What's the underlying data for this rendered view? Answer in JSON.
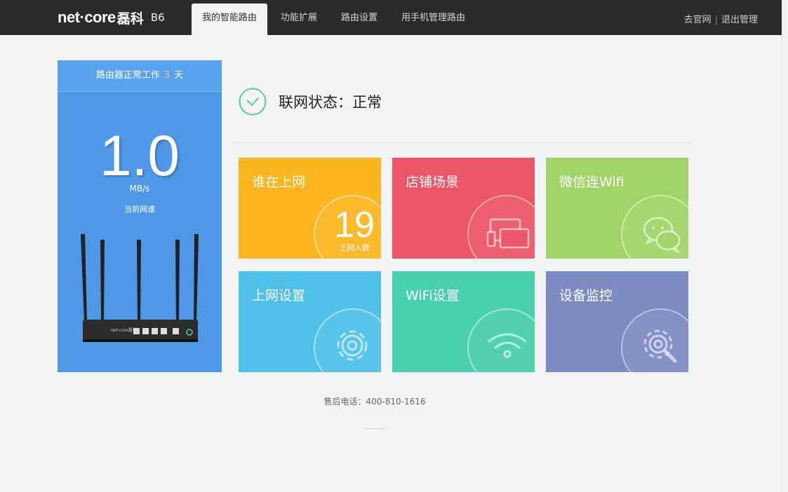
{
  "header": {
    "brand": "net·core",
    "brand_cn": "磊科",
    "model": "B6",
    "tabs": [
      {
        "label": "我的智能路由",
        "active": true
      },
      {
        "label": "功能扩展",
        "active": false
      },
      {
        "label": "路由设置",
        "active": false
      },
      {
        "label": "用手机管理路由",
        "active": false
      }
    ],
    "links": {
      "official": "去官网",
      "separator": "|",
      "logout": "退出管理"
    }
  },
  "uptime": {
    "prefix": "路由器正常工作",
    "days": "3",
    "suffix": "天"
  },
  "speed": {
    "value": "1.0",
    "unit": "MB/s",
    "label": "当前网速"
  },
  "status": {
    "text": "联网状态：正常",
    "icon": "check-circle-icon",
    "color": "#5bc7a5"
  },
  "tiles": [
    {
      "title": "谁在上网",
      "color": "#fbb51f",
      "count": "19",
      "count_label": "上网人数"
    },
    {
      "title": "店铺场景",
      "color": "#ec5467",
      "icon": "shop-screen-icon"
    },
    {
      "title": "微信连Wifi",
      "color": "#a0d468",
      "icon": "wechat-icon"
    },
    {
      "title": "上网设置",
      "color": "#4fc1e9",
      "icon": "gear-icon"
    },
    {
      "title": "WiFi设置",
      "color": "#48cfad",
      "icon": "wifi-icon"
    },
    {
      "title": "设备监控",
      "color": "#7e8bc1",
      "icon": "monitor-gear-icon"
    }
  ],
  "router_labels": {
    "brand": "net·core磊科"
  },
  "footer": {
    "tel": "售后电话：400-810-1616"
  }
}
